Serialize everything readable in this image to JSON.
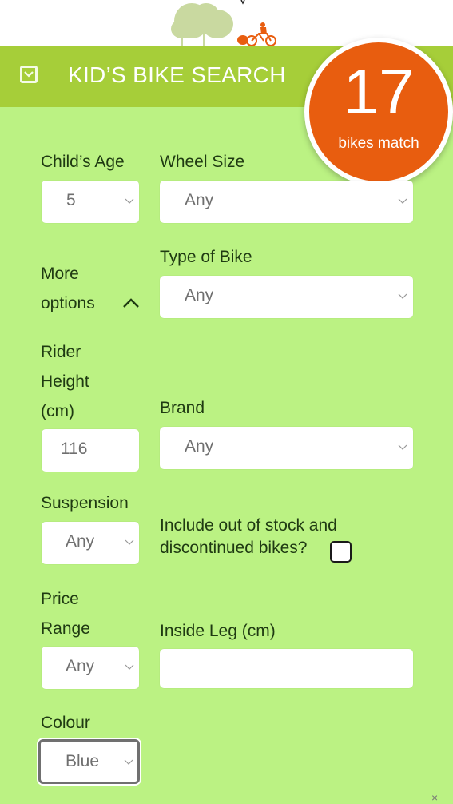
{
  "header": {
    "title": "KID’S BIKE SEARCH",
    "toggle_icon": "checkbox-chevron-down-icon"
  },
  "match_badge": {
    "count": "17",
    "label": "bikes match",
    "color": "#e85d0f"
  },
  "colors": {
    "header_bar": "#a6ce39",
    "form_background": "#bbf283",
    "label_text": "#1f3a12"
  },
  "form": {
    "childs_age": {
      "label": "Child’s Age",
      "value": "5"
    },
    "wheel_size": {
      "label": "Wheel Size",
      "value": "Any"
    },
    "more_options": {
      "label_line1": "More",
      "label_line2": "options",
      "icon": "chevron-up-icon"
    },
    "type_of_bike": {
      "label": "Type of Bike",
      "value": "Any"
    },
    "rider_height": {
      "label_line1": "Rider",
      "label_line2": "Height",
      "label_line3": "(cm)",
      "value": "116"
    },
    "brand": {
      "label": "Brand",
      "value": "Any"
    },
    "suspension": {
      "label": "Suspension",
      "value": "Any"
    },
    "include_out_of_stock": {
      "label_line1": "Include out of stock and",
      "label_line2": "discontinued bikes?",
      "checked": false
    },
    "price_range": {
      "label_line1": "Price",
      "label_line2": "Range",
      "value": "Any"
    },
    "inside_leg": {
      "label": "Inside Leg (cm)",
      "value": ""
    },
    "colour": {
      "label": "Colour",
      "value": "Blue"
    }
  },
  "close_icon": "×"
}
